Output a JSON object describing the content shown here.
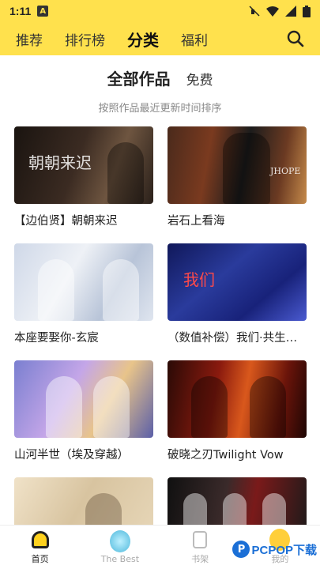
{
  "status": {
    "time": "1:11",
    "badge": "A"
  },
  "nav": {
    "tabs": [
      "推荐",
      "排行榜",
      "分类",
      "福利"
    ],
    "active_index": 2
  },
  "filter": {
    "main": "全部作品",
    "sub": "免费"
  },
  "sort_note": "按照作品最近更新时间排序",
  "works": [
    {
      "title": "【边伯贤】朝朝来迟",
      "thumb_text": "朝朝来迟"
    },
    {
      "title": "岩石上看海",
      "thumb_text": "JHOPE"
    },
    {
      "title": "本座要娶你-玄宸",
      "thumb_text": ""
    },
    {
      "title": "（数值补偿）我们·共生…",
      "thumb_text": "我们"
    },
    {
      "title": "山河半世（埃及穿越）",
      "thumb_text": ""
    },
    {
      "title": "破晓之刃Twilight Vow",
      "thumb_text": ""
    },
    {
      "title": "",
      "thumb_text": ""
    },
    {
      "title": "",
      "thumb_text": ""
    }
  ],
  "bottom_nav": [
    {
      "label": "首页",
      "icon": "home-icon"
    },
    {
      "label": "The Best",
      "icon": "the-best-icon"
    },
    {
      "label": "书架",
      "icon": "bookshelf-icon"
    },
    {
      "label": "我的",
      "icon": "profile-icon"
    }
  ],
  "watermark": {
    "logo_letter": "P",
    "text": "PCPOP下载"
  },
  "colors": {
    "accent": "#ffe14d",
    "watermark": "#1b6fd6"
  }
}
